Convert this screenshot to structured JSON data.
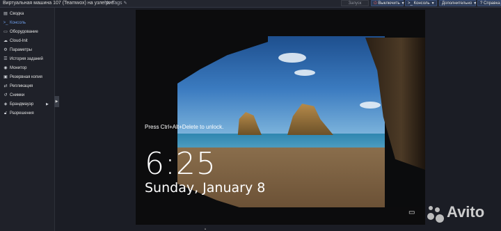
{
  "header": {
    "title": "Виртуальная машина 107 (Teamwox) на узле pve",
    "tags": "No Tags"
  },
  "toolbar": {
    "start": "Запуск",
    "shutdown": "Выключить",
    "console": "Консоль",
    "more": "Дополнительно",
    "help": "Справка"
  },
  "sidebar": {
    "items": [
      {
        "label": "Сводка",
        "icon": "summary-icon"
      },
      {
        "label": "Консоль",
        "icon": "terminal-icon"
      },
      {
        "label": "Оборудование",
        "icon": "monitor-icon"
      },
      {
        "label": "Cloud-Init",
        "icon": "cloud-icon"
      },
      {
        "label": "Параметры",
        "icon": "gear-icon"
      },
      {
        "label": "История заданий",
        "icon": "list-icon"
      },
      {
        "label": "Монитор",
        "icon": "eye-icon"
      },
      {
        "label": "Резервная копия",
        "icon": "floppy-icon"
      },
      {
        "label": "Репликация",
        "icon": "retweet-icon"
      },
      {
        "label": "Снимки",
        "icon": "history-icon"
      },
      {
        "label": "Брандмауэр",
        "icon": "shield-icon"
      },
      {
        "label": "Разрешения",
        "icon": "unlock-icon"
      }
    ]
  },
  "lockscreen": {
    "hint": "Press Ctrl+Alt+Delete to unlock.",
    "time": "6:25",
    "date": "Sunday, January 8"
  },
  "watermark": {
    "text": "Avito"
  }
}
